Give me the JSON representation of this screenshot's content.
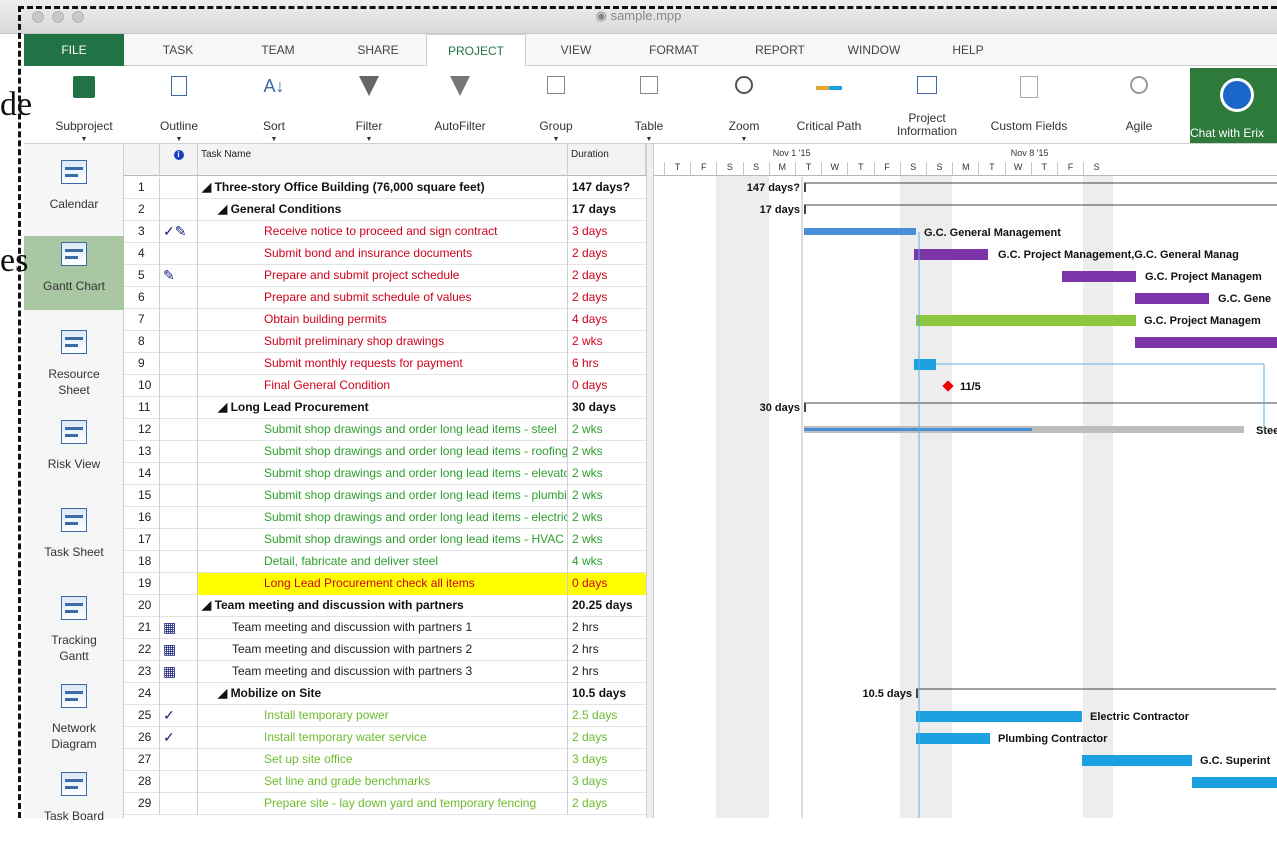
{
  "window": {
    "title": "sample.mpp"
  },
  "ghost": [
    "de",
    "es"
  ],
  "tabs": [
    "FILE",
    "TASK",
    "TEAM",
    "SHARE",
    "PROJECT",
    "VIEW",
    "FORMAT",
    "REPORT",
    "WINDOW",
    "HELP"
  ],
  "ribbon": {
    "subproject": "Subproject",
    "outline": "Outline",
    "sort": "Sort",
    "filter": "Filter",
    "autofilter": "AutoFilter",
    "group": "Group",
    "table": "Table",
    "zoom": "Zoom",
    "critical": "Critical Path",
    "projinfo": "Project\nInformation",
    "custom": "Custom Fields",
    "agile": "Agile",
    "chat": "Chat with Erix"
  },
  "views": [
    "Calendar",
    "Gantt Chart",
    "Resource\nSheet",
    "Risk View",
    "Task Sheet",
    "Tracking\nGantt",
    "Network\nDiagram",
    "Task Board"
  ],
  "grid": {
    "task_name_header": "Task Name",
    "duration_header": "Duration",
    "rows": [
      [
        "1",
        "",
        "◢ Three-story Office Building (76,000 square feet)",
        "147 days?",
        "b",
        0
      ],
      [
        "2",
        "",
        "◢ General Conditions",
        "17 days",
        "b",
        1
      ],
      [
        "3",
        "✓✎",
        "Receive notice to proceed and sign contract",
        "3 days",
        "r",
        2
      ],
      [
        "4",
        "",
        "Submit bond and insurance documents",
        "2 days",
        "r",
        2
      ],
      [
        "5",
        "✎",
        "Prepare and submit project schedule",
        "2 days",
        "r",
        2
      ],
      [
        "6",
        "",
        "Prepare and submit schedule of values",
        "2 days",
        "r",
        2
      ],
      [
        "7",
        "",
        "Obtain building permits",
        "4 days",
        "r",
        2
      ],
      [
        "8",
        "",
        "Submit preliminary shop drawings",
        "2 wks",
        "r",
        2
      ],
      [
        "9",
        "",
        "Submit monthly requests for payment",
        "6 hrs",
        "r",
        2
      ],
      [
        "10",
        "",
        "Final General Condition",
        "0 days",
        "r",
        2
      ],
      [
        "11",
        "",
        "◢ Long Lead Procurement",
        "30 days",
        "b",
        1
      ],
      [
        "12",
        "",
        "Submit shop drawings and order long lead items - steel",
        "2 wks",
        "g",
        2
      ],
      [
        "13",
        "",
        "Submit shop drawings and order long lead items - roofing",
        "2 wks",
        "g",
        2
      ],
      [
        "14",
        "",
        "Submit shop drawings and order long lead items - elevator",
        "2 wks",
        "g",
        2
      ],
      [
        "15",
        "",
        "Submit shop drawings and order long lead items - plumbing",
        "2 wks",
        "g",
        2
      ],
      [
        "16",
        "",
        "Submit shop drawings and order long lead items - electric",
        "2 wks",
        "g",
        2
      ],
      [
        "17",
        "",
        "Submit shop drawings and order long lead items - HVAC",
        "2 wks",
        "g",
        2
      ],
      [
        "18",
        "",
        "Detail, fabricate and deliver steel",
        "4 wks",
        "g",
        2
      ],
      [
        "19",
        "",
        "Long Lead Procurement check all items",
        "0 days",
        "rh",
        2
      ],
      [
        "20",
        "",
        "◢ Team meeting and discussion with partners",
        "20.25 days",
        "b",
        0
      ],
      [
        "21",
        "▦",
        "Team meeting and discussion with partners 1",
        "2 hrs",
        "k",
        1
      ],
      [
        "22",
        "▦",
        "Team meeting and discussion with partners 2",
        "2 hrs",
        "k",
        1
      ],
      [
        "23",
        "▦",
        "Team meeting and discussion with partners 3",
        "2 hrs",
        "k",
        1
      ],
      [
        "24",
        "",
        "◢ Mobilize on Site",
        "10.5 days",
        "b",
        1
      ],
      [
        "25",
        "✓",
        "Install temporary power",
        "2.5 days",
        "lg",
        2
      ],
      [
        "26",
        "✓",
        "Install temporary water service",
        "2 days",
        "lg",
        2
      ],
      [
        "27",
        "",
        "Set up site office",
        "3 days",
        "lg",
        2
      ],
      [
        "28",
        "",
        "Set line and grade benchmarks",
        "3 days",
        "lg",
        2
      ],
      [
        "29",
        "",
        "Prepare site - lay down yard and temporary fencing",
        "2 days",
        "lg",
        2
      ]
    ]
  },
  "timescale": {
    "weeks": [
      "Nov 1 '15",
      "Nov 8 '15"
    ],
    "days": [
      "T",
      "F",
      "S",
      "S",
      "M",
      "T",
      "W",
      "T",
      "F",
      "S",
      "S",
      "M",
      "T",
      "W",
      "T",
      "F",
      "S"
    ]
  },
  "gantt_labels": {
    "r1": "147 days?",
    "r2": "17 days",
    "r3": "G.C. General Management",
    "r4": "G.C. Project Management,G.C. General Manag",
    "r5": "G.C. Project Managem",
    "r6": "G.C. Gene",
    "r7": "G.C. Project Managem",
    "r10": "11/5",
    "r11": "30 days",
    "r12": "Stee",
    "r24": "10.5 days",
    "r25": "Electric Contractor",
    "r26": "Plumbing Contractor",
    "r27": "G.C. Superint"
  },
  "colors": {
    "blue": "#1ba1e2",
    "purple": "#7b35a8",
    "green": "#8cc63f",
    "gray": "#bdbdbd",
    "accent": "#217346"
  }
}
